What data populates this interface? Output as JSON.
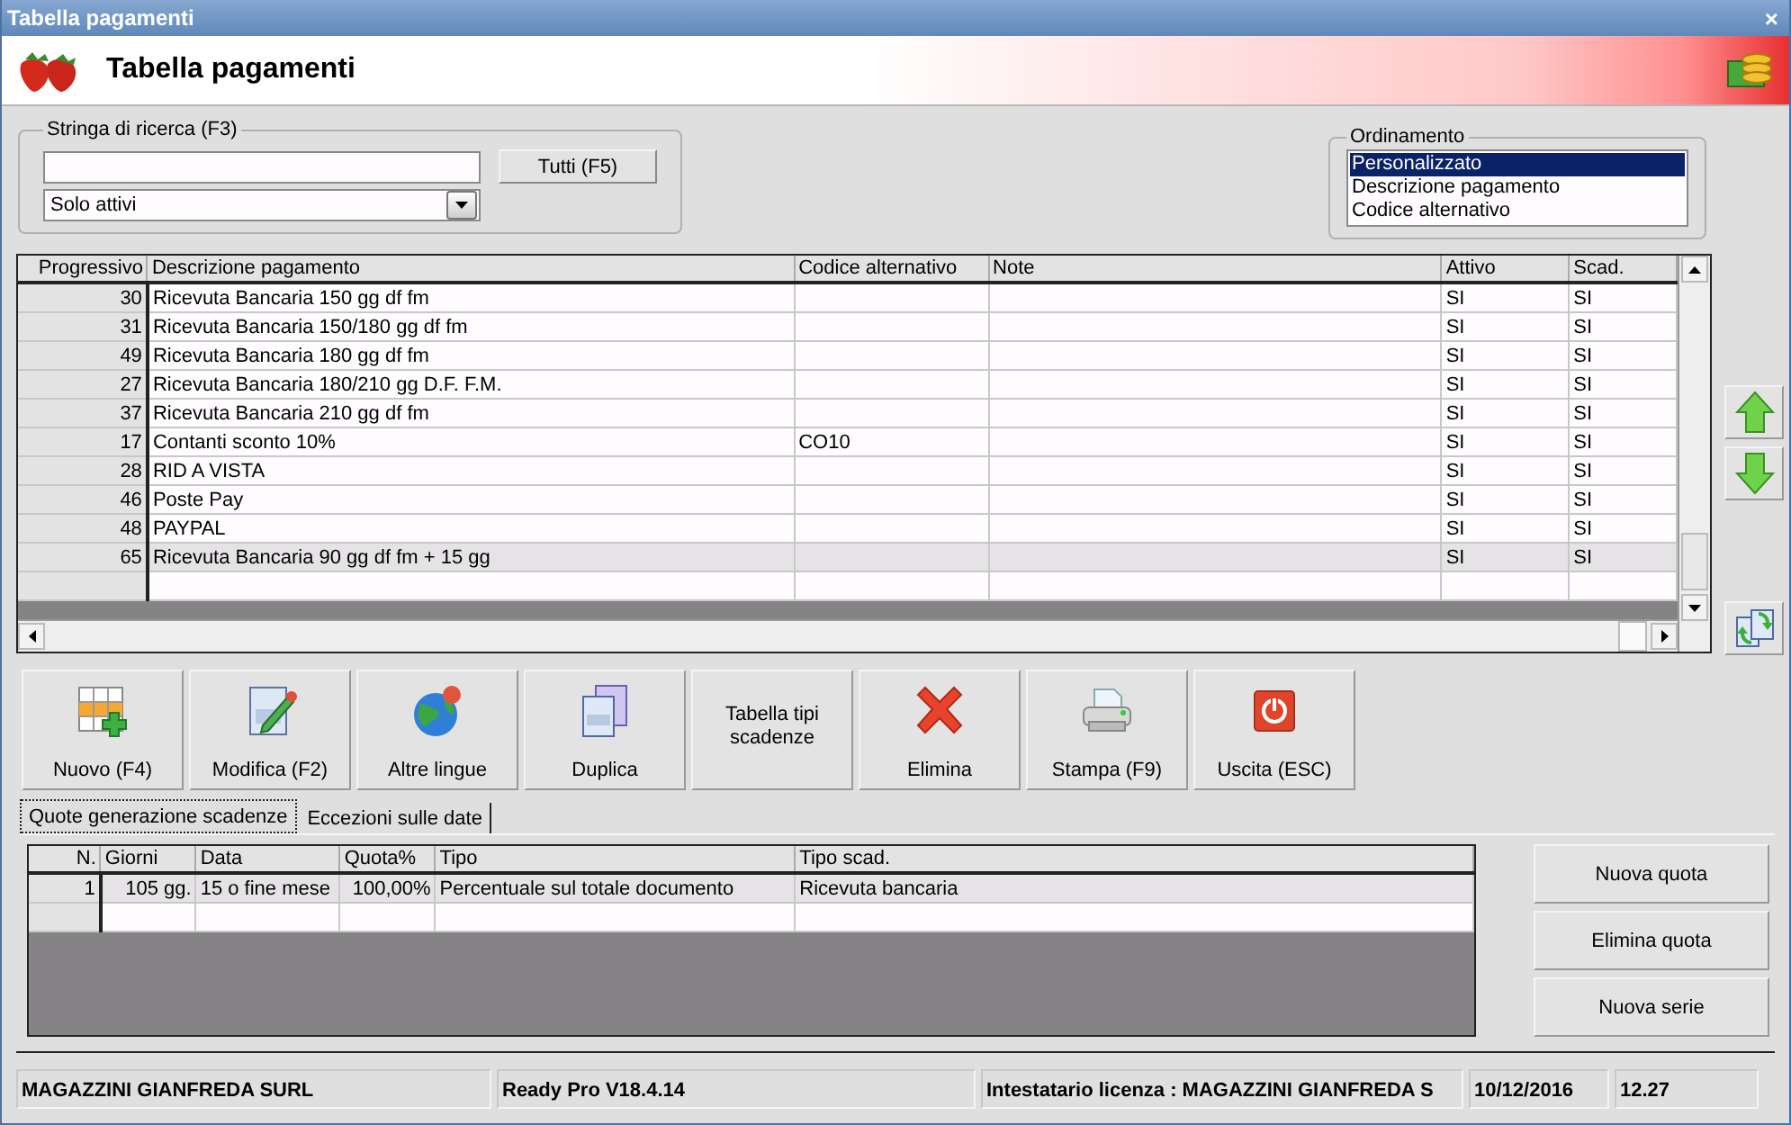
{
  "window": {
    "title": "Tabella pagamenti",
    "close": "×"
  },
  "header": {
    "title": "Tabella pagamenti"
  },
  "search": {
    "label": "Stringa di ricerca (F3)",
    "all_button": "Tutti (F5)",
    "filter": "Solo attivi"
  },
  "ordering": {
    "label": "Ordinamento",
    "options": [
      {
        "label": "Personalizzato",
        "selected": true
      },
      {
        "label": "Descrizione pagamento",
        "selected": false
      },
      {
        "label": "Codice alternativo",
        "selected": false
      }
    ]
  },
  "table": {
    "columns": [
      "Progressivo",
      "Descrizione pagamento",
      "Codice alternativo",
      "Note",
      "Attivo",
      "Scad."
    ],
    "rows": [
      {
        "progressivo": "30",
        "descrizione": "Ricevuta Bancaria 150 gg df fm",
        "attivo": "SI",
        "scad": "SI",
        "selected": false
      },
      {
        "progressivo": "31",
        "descrizione": "Ricevuta Bancaria 150/180 gg df fm",
        "attivo": "SI",
        "scad": "SI",
        "selected": false
      },
      {
        "progressivo": "49",
        "descrizione": "Ricevuta Bancaria 180 gg df fm",
        "attivo": "SI",
        "scad": "SI",
        "selected": false
      },
      {
        "progressivo": "27",
        "descrizione": "Ricevuta Bancaria 180/210 gg D.F. F.M.",
        "attivo": "SI",
        "scad": "SI",
        "selected": false
      },
      {
        "progressivo": "37",
        "descrizione": "Ricevuta Bancaria 210 gg df fm",
        "attivo": "SI",
        "scad": "SI",
        "selected": false
      },
      {
        "progressivo": "17",
        "descrizione": "Contanti sconto 10%",
        "codice": "CO10",
        "attivo": "SI",
        "scad": "SI",
        "selected": false
      },
      {
        "progressivo": "28",
        "descrizione": "RID A VISTA",
        "attivo": "SI",
        "scad": "SI",
        "selected": false
      },
      {
        "progressivo": "46",
        "descrizione": "Poste Pay",
        "attivo": "SI",
        "scad": "SI",
        "selected": false
      },
      {
        "progressivo": "48",
        "descrizione": "PAYPAL",
        "attivo": "SI",
        "scad": "SI",
        "selected": false
      },
      {
        "progressivo": "65",
        "descrizione": "Ricevuta Bancaria 90 gg df fm + 15 gg",
        "attivo": "SI",
        "scad": "SI",
        "selected": true
      }
    ]
  },
  "toolbar": [
    {
      "label": "Nuovo (F4)",
      "kind": "new"
    },
    {
      "label": "Modifica (F2)",
      "kind": "edit"
    },
    {
      "label": "Altre lingue",
      "kind": "languages"
    },
    {
      "label": "Duplica",
      "kind": "duplicate"
    },
    {
      "label": "Tabella tipi scadenze",
      "kind": "text"
    },
    {
      "label": "Elimina",
      "kind": "delete"
    },
    {
      "label": "Stampa (F9)",
      "kind": "print"
    },
    {
      "label": "Uscita (ESC)",
      "kind": "exit"
    }
  ],
  "tabs": [
    {
      "label": "Quote generazione scadenze",
      "selected": true
    },
    {
      "label": "Eccezioni sulle date",
      "selected": false
    }
  ],
  "quote_table": {
    "columns": [
      "N.",
      "Giorni",
      "Data",
      "Quota%",
      "Tipo",
      "Tipo scad."
    ],
    "rows": [
      {
        "n": "1",
        "giorni": "105 gg.",
        "data": "15 o fine mese",
        "quota": "100,00%",
        "tipo": "Percentuale sul totale documento",
        "tipo_scad": "Ricevuta bancaria",
        "selected": true
      }
    ]
  },
  "quote_buttons": [
    "Nuova quota",
    "Elimina quota",
    "Nuova serie"
  ],
  "status_bar": [
    "MAGAZZINI GIANFREDA SURL",
    "Ready Pro V18.4.14",
    "Intestatario licenza : MAGAZZINI GIANFREDA S",
    "10/12/2016",
    "12.27"
  ]
}
